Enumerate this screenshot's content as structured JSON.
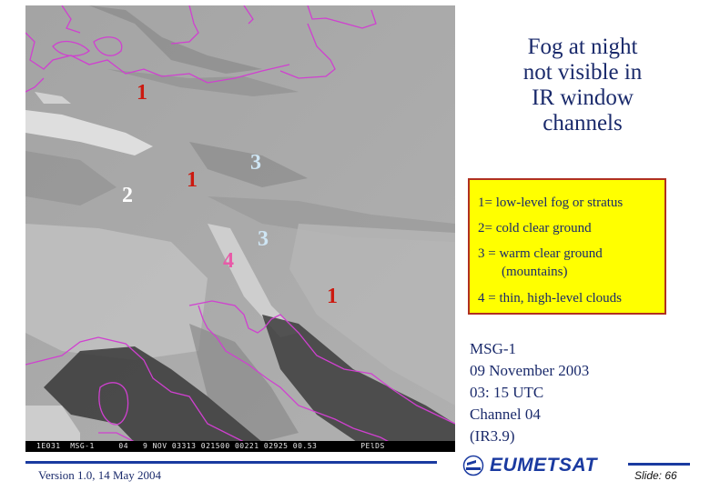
{
  "slide": {
    "title": "Fog at night not visible in IR window channels",
    "title_lines": [
      "Fog at night",
      "not visible in",
      "IR window",
      "channels"
    ],
    "legend": {
      "items": [
        {
          "text": "1= low-level fog or stratus"
        },
        {
          "text": "2= cold clear ground"
        },
        {
          "text": "3 = warm clear ground",
          "sub": "(mountains)"
        },
        {
          "text": "4 = thin, high-level clouds"
        }
      ]
    },
    "image_info": [
      "MSG-1",
      "09 November 2003",
      "03: 15 UTC",
      "Channel 04",
      "(IR3.9)"
    ],
    "image_caption": "1E031  MSG-1     04   9 NOV 03313 021500 00221 02925 00.53         PElDS",
    "markers": [
      {
        "label": "1",
        "color": "#cc1a10"
      },
      {
        "label": "2",
        "color": "#ffffff"
      },
      {
        "label": "1",
        "color": "#cc1a10"
      },
      {
        "label": "3",
        "color": "#cfe6f5"
      },
      {
        "label": "3",
        "color": "#cfe6f5"
      },
      {
        "label": "4",
        "color": "#e85aa8"
      },
      {
        "label": "1",
        "color": "#cc1a10"
      }
    ],
    "footer": {
      "version": "Version 1.0, 14 May 2004",
      "logo_text": "EUMETSAT",
      "slide_number": "Slide: 66"
    },
    "colors": {
      "text_navy": "#1a2a6b",
      "accent_blue": "#1a3aa0",
      "legend_bg": "#ffff00",
      "legend_border": "#b03020",
      "coastline": "#d040d0"
    }
  }
}
